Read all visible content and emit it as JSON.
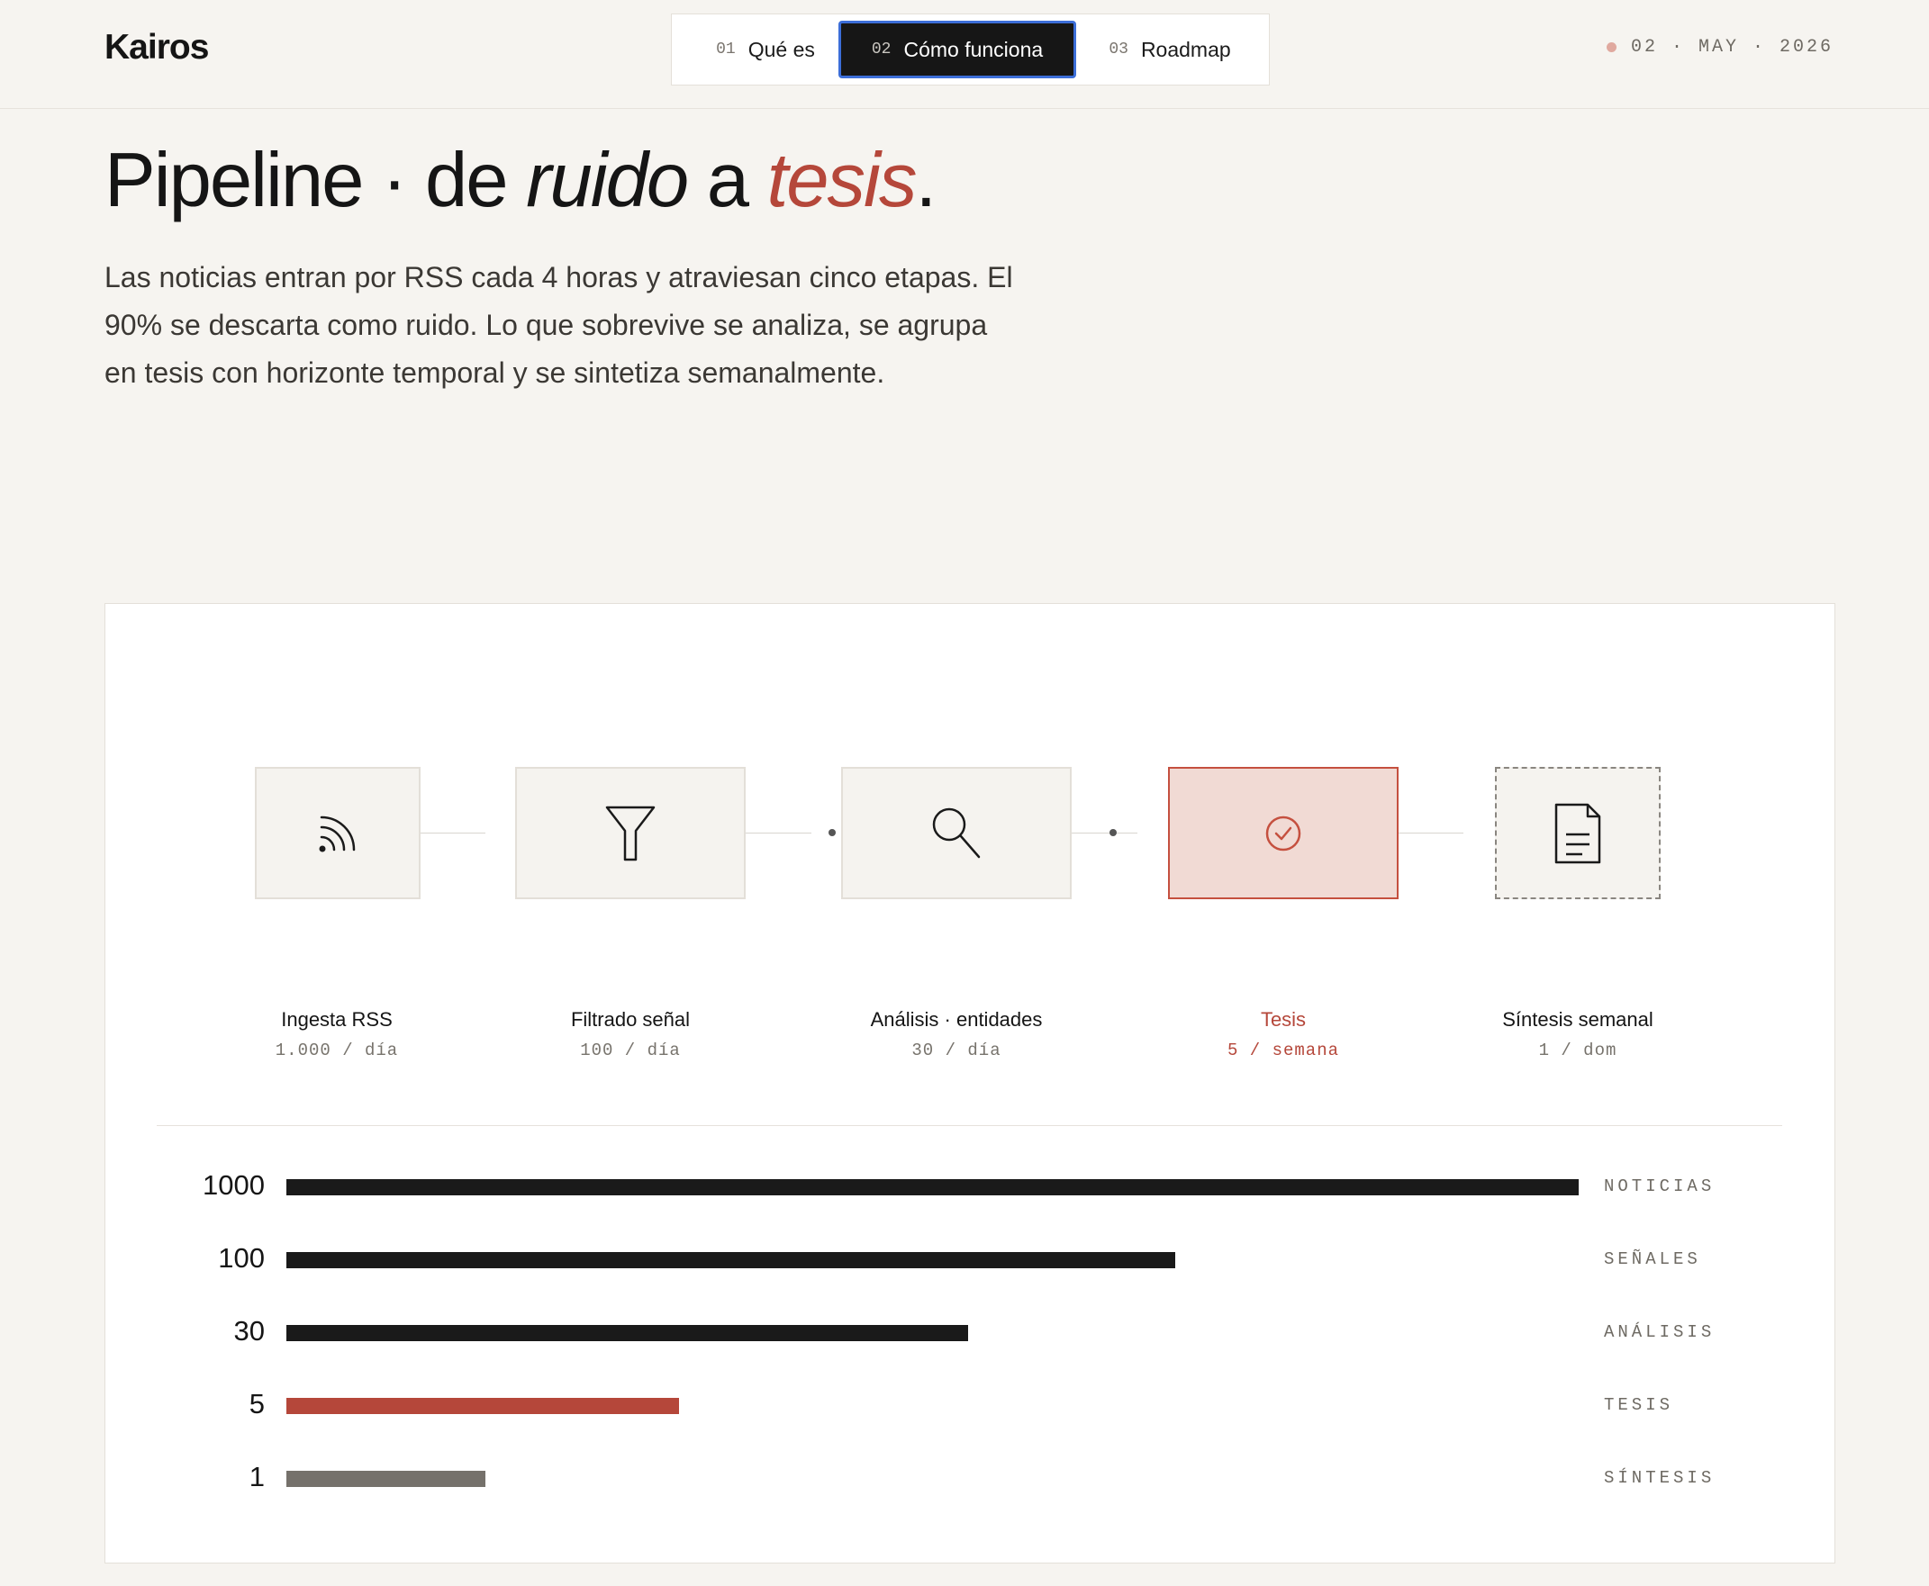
{
  "header": {
    "brand": "Kairos",
    "nav": [
      {
        "num": "01",
        "label": "Qué es",
        "active": false
      },
      {
        "num": "02",
        "label": "Cómo funciona",
        "active": true
      },
      {
        "num": "03",
        "label": "Roadmap",
        "active": false
      }
    ],
    "date": "02 · MAY · 2026",
    "status_color": "#e0a99f"
  },
  "hero": {
    "title_a": "Pipeline · de ",
    "title_b": "ruido",
    "title_c": " a ",
    "title_d": "tesis",
    "title_e": ".",
    "lead": "Las noticias entran por RSS cada 4 horas y atraviesan cinco etapas. El 90% se descarta como ruido. Lo que sobrevive se analiza, se agrupa en tesis con horizonte temporal y se sintetiza semanalmente."
  },
  "pipeline": {
    "stages": [
      {
        "label": "Ingesta RSS",
        "rate": "1.000 / día",
        "icon": "rss-icon"
      },
      {
        "label": "Filtrado señal",
        "rate": "100 / día",
        "icon": "funnel-icon"
      },
      {
        "label": "Análisis · entidades",
        "rate": "30 / día",
        "icon": "search-icon"
      },
      {
        "label": "Tesis",
        "rate": "5 / semana",
        "icon": "check-circle-icon"
      },
      {
        "label": "Síntesis semanal",
        "rate": "1 / dom",
        "icon": "document-icon"
      }
    ],
    "accent_color": "#b5473a"
  },
  "chart_data": {
    "type": "bar",
    "orientation": "horizontal",
    "categories": [
      "NOTICIAS",
      "SEÑALES",
      "ANÁLISIS",
      "TESIS",
      "SÍNTESIS"
    ],
    "values": [
      1000,
      100,
      30,
      5,
      1
    ],
    "labels": [
      "1000",
      "100",
      "30",
      "5",
      "1"
    ],
    "scale": "log",
    "colors": [
      "#1a1a1a",
      "#1a1a1a",
      "#1a1a1a",
      "#b5473a",
      "#75716b"
    ],
    "grid": false,
    "legend": "none"
  }
}
